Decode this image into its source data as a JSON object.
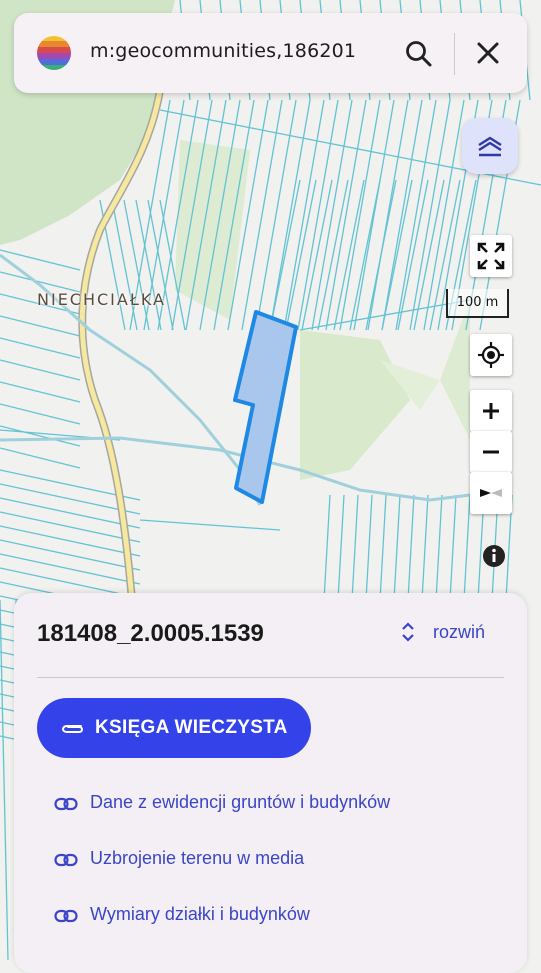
{
  "search": {
    "query": "m:geocommunities,186201",
    "logo_icon": "app-logo-rainbow-icon",
    "search_icon": "search-icon",
    "close_icon": "close-icon"
  },
  "map": {
    "place_label": "NIECHCIAŁKA",
    "scale_label": "100 m",
    "layers_icon": "layers-icon",
    "controls": [
      "fullscreen-icon",
      "locate-icon",
      "zoom-in-icon",
      "zoom-out-icon",
      "compass-icon"
    ],
    "info_icon": "info-icon",
    "colors": {
      "parcel_fill": "#a9c7ec",
      "parcel_stroke": "#1e88e5",
      "parcel_lines": "#5fc3d2",
      "road": "#f5e59a",
      "forest": "#cfe4c5",
      "field": "#e3efd8"
    }
  },
  "panel": {
    "parcel_id": "181408_2.0005.1539",
    "expand_label": "rozwiń",
    "primary_button": "KSIĘGA WIECZYSTA",
    "links": [
      "Dane z ewidencji gruntów i budynków",
      "Uzbrojenie terenu w media",
      "Wymiary działki i budynków"
    ],
    "colors": {
      "accent": "#3442ea",
      "link": "#3a46c7"
    }
  }
}
